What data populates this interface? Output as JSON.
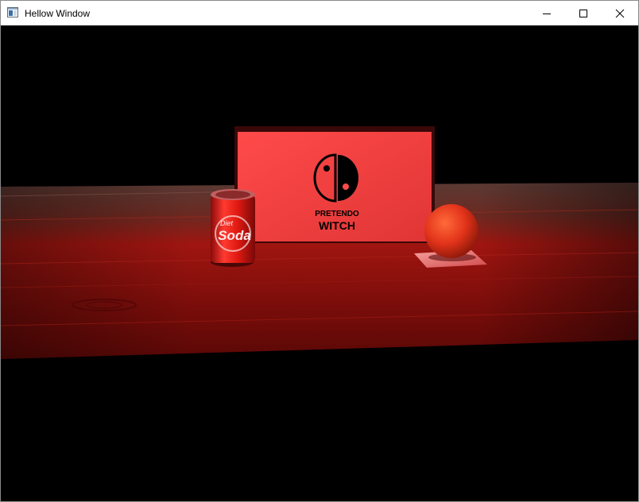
{
  "window": {
    "title": "Hellow Window",
    "controls": {
      "minimize": "minimize",
      "maximize": "maximize",
      "close": "close"
    }
  },
  "scene": {
    "sign": {
      "line1": "PRETENDO",
      "line2": "WITCH"
    },
    "can": {
      "word1": "Diet",
      "word2": "Soda"
    },
    "colors": {
      "background": "#000000",
      "table_top": "#7a1410",
      "sign_face": "#f03a3a",
      "ball": "#e8351a"
    }
  }
}
